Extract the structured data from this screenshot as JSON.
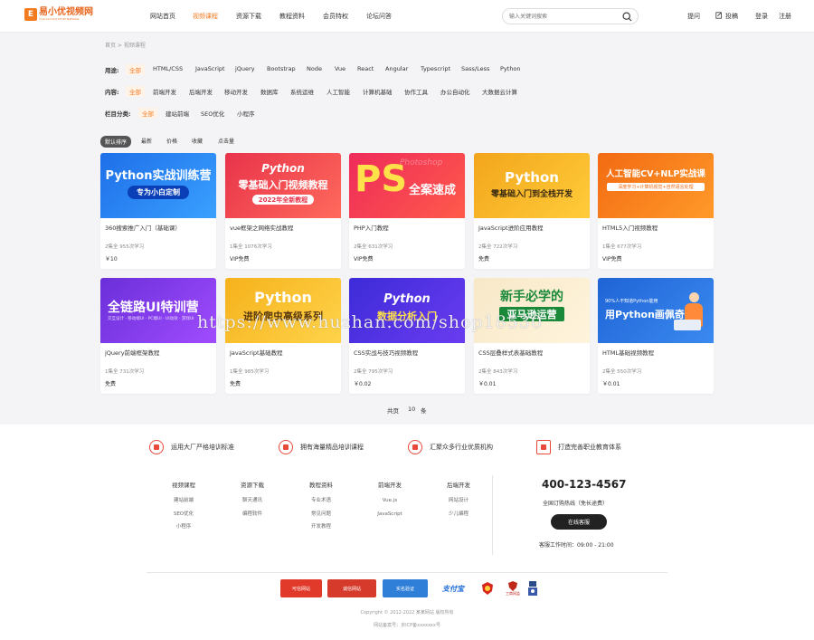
{
  "logo": {
    "text": "易小优视频网",
    "sub": "YIXIAOYOUSHIPINWANG",
    "mark": "E"
  },
  "nav": [
    {
      "label": "网站首页",
      "active": false
    },
    {
      "label": "视频课程",
      "active": true
    },
    {
      "label": "资源下载",
      "active": false
    },
    {
      "label": "教程资料",
      "active": false
    },
    {
      "label": "会员特权",
      "active": false
    },
    {
      "label": "论坛问答",
      "active": false
    }
  ],
  "search": {
    "placeholder": "输入关键词搜索"
  },
  "topright": {
    "help": "提问",
    "submit": "投稿",
    "login": "登录",
    "register": "注册"
  },
  "breadcrumb": "首页 > 视频课程",
  "filters": [
    {
      "label": "用途:",
      "options": [
        "全部",
        "HTML/CSS",
        "JavaScript",
        "jQuery",
        "Bootstrap",
        "Node",
        "Vue",
        "React",
        "Angular",
        "Typescript",
        "Sass/Less",
        "Python"
      ]
    },
    {
      "label": "内容:",
      "options": [
        "全部",
        "前端开发",
        "后端开发",
        "移动开发",
        "数据库",
        "系统运维",
        "人工智能",
        "计算机基础",
        "协作工具",
        "办公自动化",
        "大数据云计算"
      ]
    },
    {
      "label": "栏目分类:",
      "options": [
        "全部",
        "建站前端",
        "SEO优化",
        "小程序"
      ]
    }
  ],
  "sort": [
    "默认排序",
    "最新",
    "价格",
    "收藏",
    "点击量"
  ],
  "courses": [
    {
      "title": "360搜索推广入门（基础课）",
      "stats": "2集全 955次学习",
      "price": "￥10",
      "thumb": {
        "line1": "Python实战训练营",
        "line2": "专为小白定制",
        "bg": "#1e6fe8",
        "bg2": "#3aa0ff",
        "fg": "#ffffff"
      }
    },
    {
      "title": "vue框架之网络实战教程",
      "stats": "1集全 1076次学习",
      "price": "VIP免费",
      "thumb": {
        "line1": "Python",
        "line2": "零基础入门视频教程",
        "line3": "2022年全新教程",
        "bg": "#e8334a",
        "bg2": "#ff6a5c",
        "fg": "#ffffff"
      }
    },
    {
      "title": "PHP入门教程",
      "stats": "2集全 631次学习",
      "price": "VIP免费",
      "thumb": {
        "line1": "PS",
        "line2": "全案速成",
        "line3": "Photoshop",
        "bg": "#ee2b5a",
        "bg2": "#ff5a4a",
        "fg": "#ffe14a"
      }
    },
    {
      "title": "JavaScript进阶应用教程",
      "stats": "2集全 722次学习",
      "price": "免费",
      "thumb": {
        "line1": "Python",
        "line2": "零基础入门到全栈开发",
        "bg": "#f3a51c",
        "bg2": "#ffcc3a",
        "fg": "#ffffff"
      }
    },
    {
      "title": "HTML5入门视频教程",
      "stats": "1集全 677次学习",
      "price": "VIP免费",
      "thumb": {
        "line1": "人工智能CV+NLP实战课",
        "line2": "深度学习+计算机视觉+自然语言处理",
        "bg": "#f36a12",
        "bg2": "#ff9a2a",
        "fg": "#ffffff"
      }
    },
    {
      "title": "jQuery前端框架教程",
      "stats": "1集全 731次学习",
      "price": "免费",
      "thumb": {
        "line1": "全链路UI特训营",
        "line2": "交互设计 · 移动端UI · PC端UI · UI动效 · 游戏UI",
        "bg": "#6a2fd8",
        "bg2": "#a04cff",
        "fg": "#ffffff"
      }
    },
    {
      "title": "JavaScript基础教程",
      "stats": "1集全 985次学习",
      "price": "免费",
      "thumb": {
        "line1": "Python",
        "line2": "进阶爬虫高级系列",
        "bg": "#f6b21c",
        "bg2": "#ffd34a",
        "fg": "#ffffff"
      }
    },
    {
      "title": "CSS实战与技巧视频教程",
      "stats": "2集全 795次学习",
      "price": "￥0.02",
      "thumb": {
        "line1": "Python",
        "line2": "数据分析入门",
        "bg": "#3d2bd8",
        "bg2": "#6a3cf0",
        "fg": "#ffffff"
      }
    },
    {
      "title": "CSS层叠样式表基础教程",
      "stats": "2集全 843次学习",
      "price": "￥0.01",
      "thumb": {
        "line1": "新手必学的",
        "line2": "亚马逊运营",
        "bg": "#f7e8c8",
        "bg2": "#fff4dc",
        "fg": "#1a8a3a"
      }
    },
    {
      "title": "HTML基础视频教程",
      "stats": "2集全 550次学习",
      "price": "￥0.01",
      "thumb": {
        "line1": "90%人不知道Python能用",
        "line2": "用Python画佩奇",
        "bg": "#1f64d6",
        "bg2": "#3b8af0",
        "fg": "#ffffff"
      }
    }
  ],
  "pager": {
    "prefix": "共页",
    "count": "10",
    "suffix": "条"
  },
  "watermark": "https://www.huzhan.com/shop18530",
  "features": [
    "运用大厂严格培训标准",
    "拥有海量精品培训课程",
    "汇聚众多行业优质机构",
    "打造完善职业教育体系"
  ],
  "footer_cols": [
    {
      "title": "视频课程",
      "links": [
        "建站前端",
        "SEO优化",
        "小程序"
      ]
    },
    {
      "title": "资源下载",
      "links": [
        "聊天通讯",
        "编程软件"
      ]
    },
    {
      "title": "教程资料",
      "links": [
        "专业术语",
        "常见问题",
        "开发教程"
      ]
    },
    {
      "title": "前端开发",
      "links": [
        "Vue.js",
        "JavaScript"
      ]
    },
    {
      "title": "后端开发",
      "links": [
        "网站设计",
        "少儿编程"
      ]
    }
  ],
  "contact": {
    "phone": "400-123-4567",
    "sub": "全国订购热线（免长途费）",
    "button": "在线客服",
    "hours": "客服工作时间：09:00 - 21:00"
  },
  "badges": [
    "可信网站",
    "诚信网站",
    "实名验证",
    "支付宝",
    "",
    "工商网监",
    ""
  ],
  "copyright": "Copyright © 2012-2022 某某网站 版权所有",
  "icp": "网站备案号：京ICP备xxxxxxx号",
  "colors": {
    "accent": "#f47a20",
    "footer_icon": "#e8493a"
  }
}
